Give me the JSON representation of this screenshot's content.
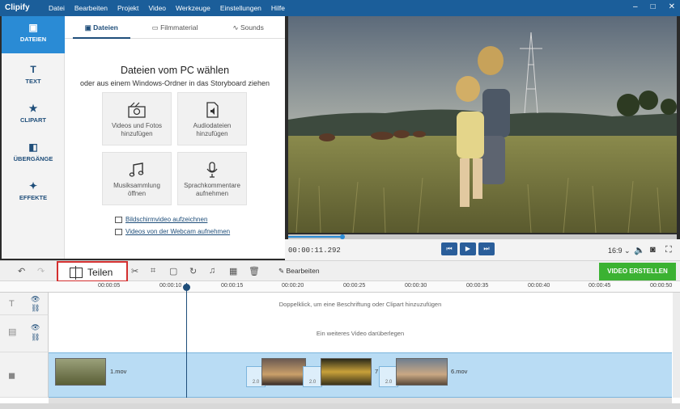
{
  "app": {
    "logo": "Clipify",
    "menu": [
      "Datei",
      "Bearbeiten",
      "Projekt",
      "Video",
      "Werkzeuge",
      "Einstellungen",
      "Hilfe"
    ],
    "window_controls": [
      "–",
      "□",
      "✕"
    ]
  },
  "rail": {
    "items": [
      {
        "label": "DATEIEN",
        "icon": "image-icon",
        "active": true
      },
      {
        "label": "TEXT",
        "icon": "text-icon",
        "active": false
      },
      {
        "label": "CLIPART",
        "icon": "star-icon",
        "active": false
      },
      {
        "label": "ÜBERGÄNGE",
        "icon": "transition-icon",
        "active": false
      },
      {
        "label": "EFFEKTE",
        "icon": "magic-wand-icon",
        "active": false
      }
    ]
  },
  "library": {
    "tabs": [
      "Dateien",
      "Filmmaterial",
      "Sounds"
    ],
    "title": "Dateien vom PC wählen",
    "subtitle": "oder aus einem Windows-Ordner in das Storyboard ziehen",
    "tiles": [
      {
        "label1": "Videos und Fotos",
        "label2": "hinzufügen"
      },
      {
        "label1": "Audiodateien",
        "label2": "hinzufügen"
      },
      {
        "label1": "Musiksammlung",
        "label2": "öffnen"
      },
      {
        "label1": "Sprachkommentare",
        "label2": "aufnehmen"
      }
    ],
    "links": [
      "Bildschirmvideo aufzeichnen",
      "Videos von der Webcam aufnehmen"
    ]
  },
  "player": {
    "timecode": "00:00:11.292",
    "progress": 0.14,
    "aspect": "16:9 ⌄"
  },
  "toolbar": {
    "split_label": "Teilen",
    "edit_label": "Bearbeiten",
    "create_label": "VIDEO ERSTELLEN"
  },
  "timeline": {
    "ticks": [
      "00:00:05",
      "00:00:10",
      "00:00:15",
      "00:00:20",
      "00:00:25",
      "00:00:30",
      "00:00:35",
      "00:00:40",
      "00:00:45",
      "00:00:50"
    ],
    "text_hint": "Doppelklick, um eine Beschriftung oder Clipart hinzuzufügen",
    "overlay_hint": "Ein weiteres Video darüberlegen",
    "clips": [
      "1.mov",
      "6.mov"
    ],
    "transition_labels": [
      "2.0",
      "2.0",
      "2.0"
    ],
    "clip_number": "7"
  },
  "colors": {
    "titlebar": "#1b5e9a",
    "accent": "#2a8bd5",
    "create_button": "#3bb232",
    "highlight": "#d32f2f"
  }
}
